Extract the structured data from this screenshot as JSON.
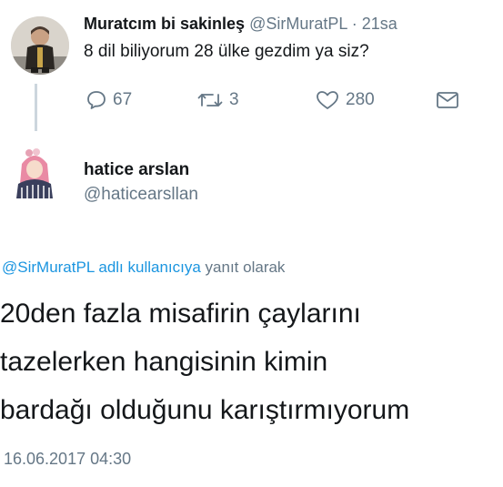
{
  "original_tweet": {
    "display_name": "Muratcım bi sakinleş",
    "handle": "@SirMuratPL",
    "separator": "·",
    "time": "21sa",
    "text": "8 dil biliyorum 28 ülke gezdim ya siz?",
    "actions": {
      "reply_count": "67",
      "retweet_count": "3",
      "like_count": "280"
    }
  },
  "reply": {
    "display_name": "hatice arslan",
    "handle": "@haticearsllan",
    "replying_to": {
      "mention": "@SirMuratPL adlı kullanıcıya",
      "suffix": " yanıt olarak"
    },
    "lines": [
      "20den fazla misafirin çaylarını",
      "tazelerken hangisinin kimin",
      "bardağı olduğunu karıştırmıyorum"
    ],
    "timestamp": "16.06.2017 04:30"
  },
  "colors": {
    "text": "#14171a",
    "muted": "#657786",
    "link": "#1b95e0",
    "thread_line": "#ccd6dd"
  }
}
